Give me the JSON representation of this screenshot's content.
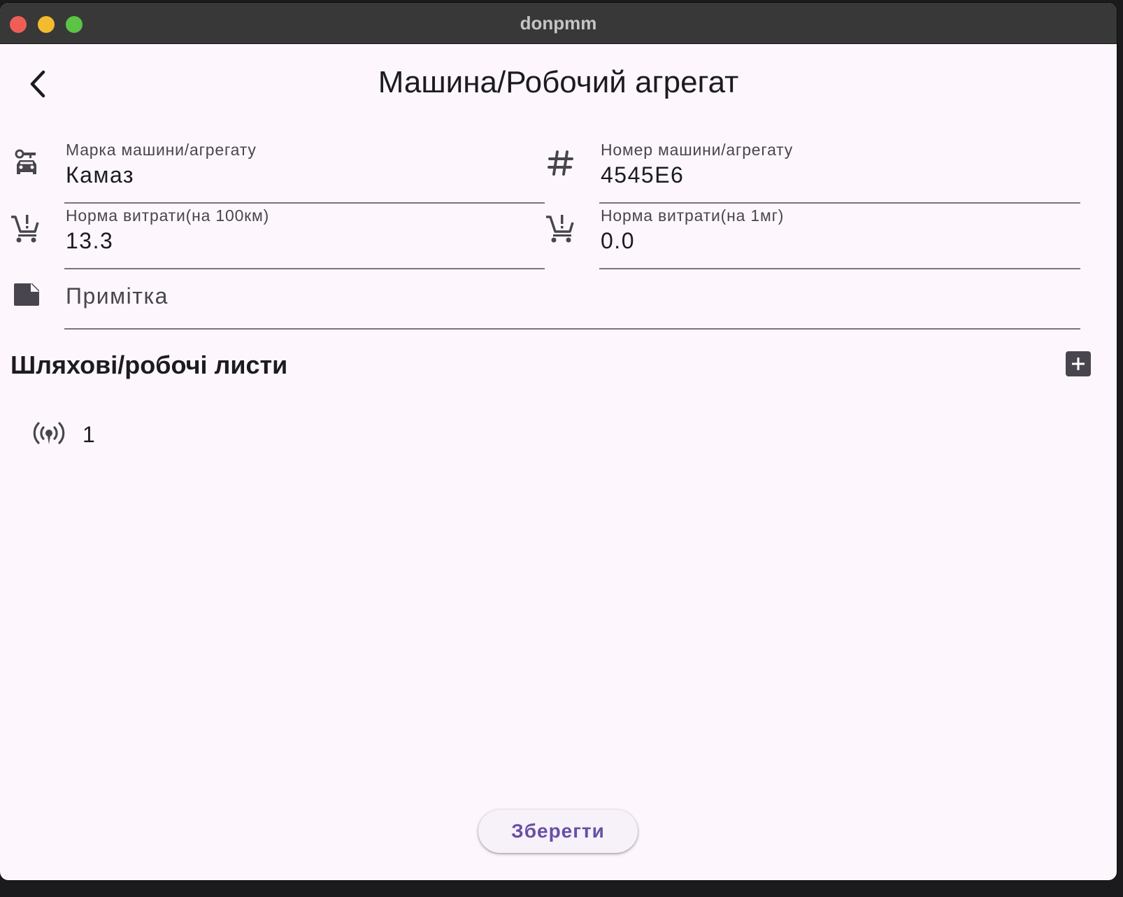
{
  "window": {
    "title": "donpmm"
  },
  "header": {
    "title": "Машина/Робочий агрегат"
  },
  "form": {
    "brand": {
      "label": "Марка машини/агрегату",
      "value": "Камаз",
      "icon": "car-rental-icon"
    },
    "number": {
      "label": "Номер машини/агрегату",
      "value": "4545Е6",
      "icon": "hash-icon"
    },
    "norm_km": {
      "label": "Норма витрати(на 100км)",
      "value": "13.3",
      "icon": "cart-icon"
    },
    "norm_mg": {
      "label": "Норма витрати(на 1мг)",
      "value": "0.0",
      "icon": "cart-icon"
    },
    "note": {
      "placeholder": "Примітка",
      "value": "",
      "icon": "note-icon"
    }
  },
  "waybills": {
    "title": "Шляхові/робочі листи",
    "items": [
      {
        "label": "1",
        "icon": "broadcast-icon"
      }
    ]
  },
  "actions": {
    "save_label": "Зберегти"
  },
  "colors": {
    "accent": "#6750a4",
    "background": "#fdf7fd",
    "titlebar": "#383838"
  }
}
